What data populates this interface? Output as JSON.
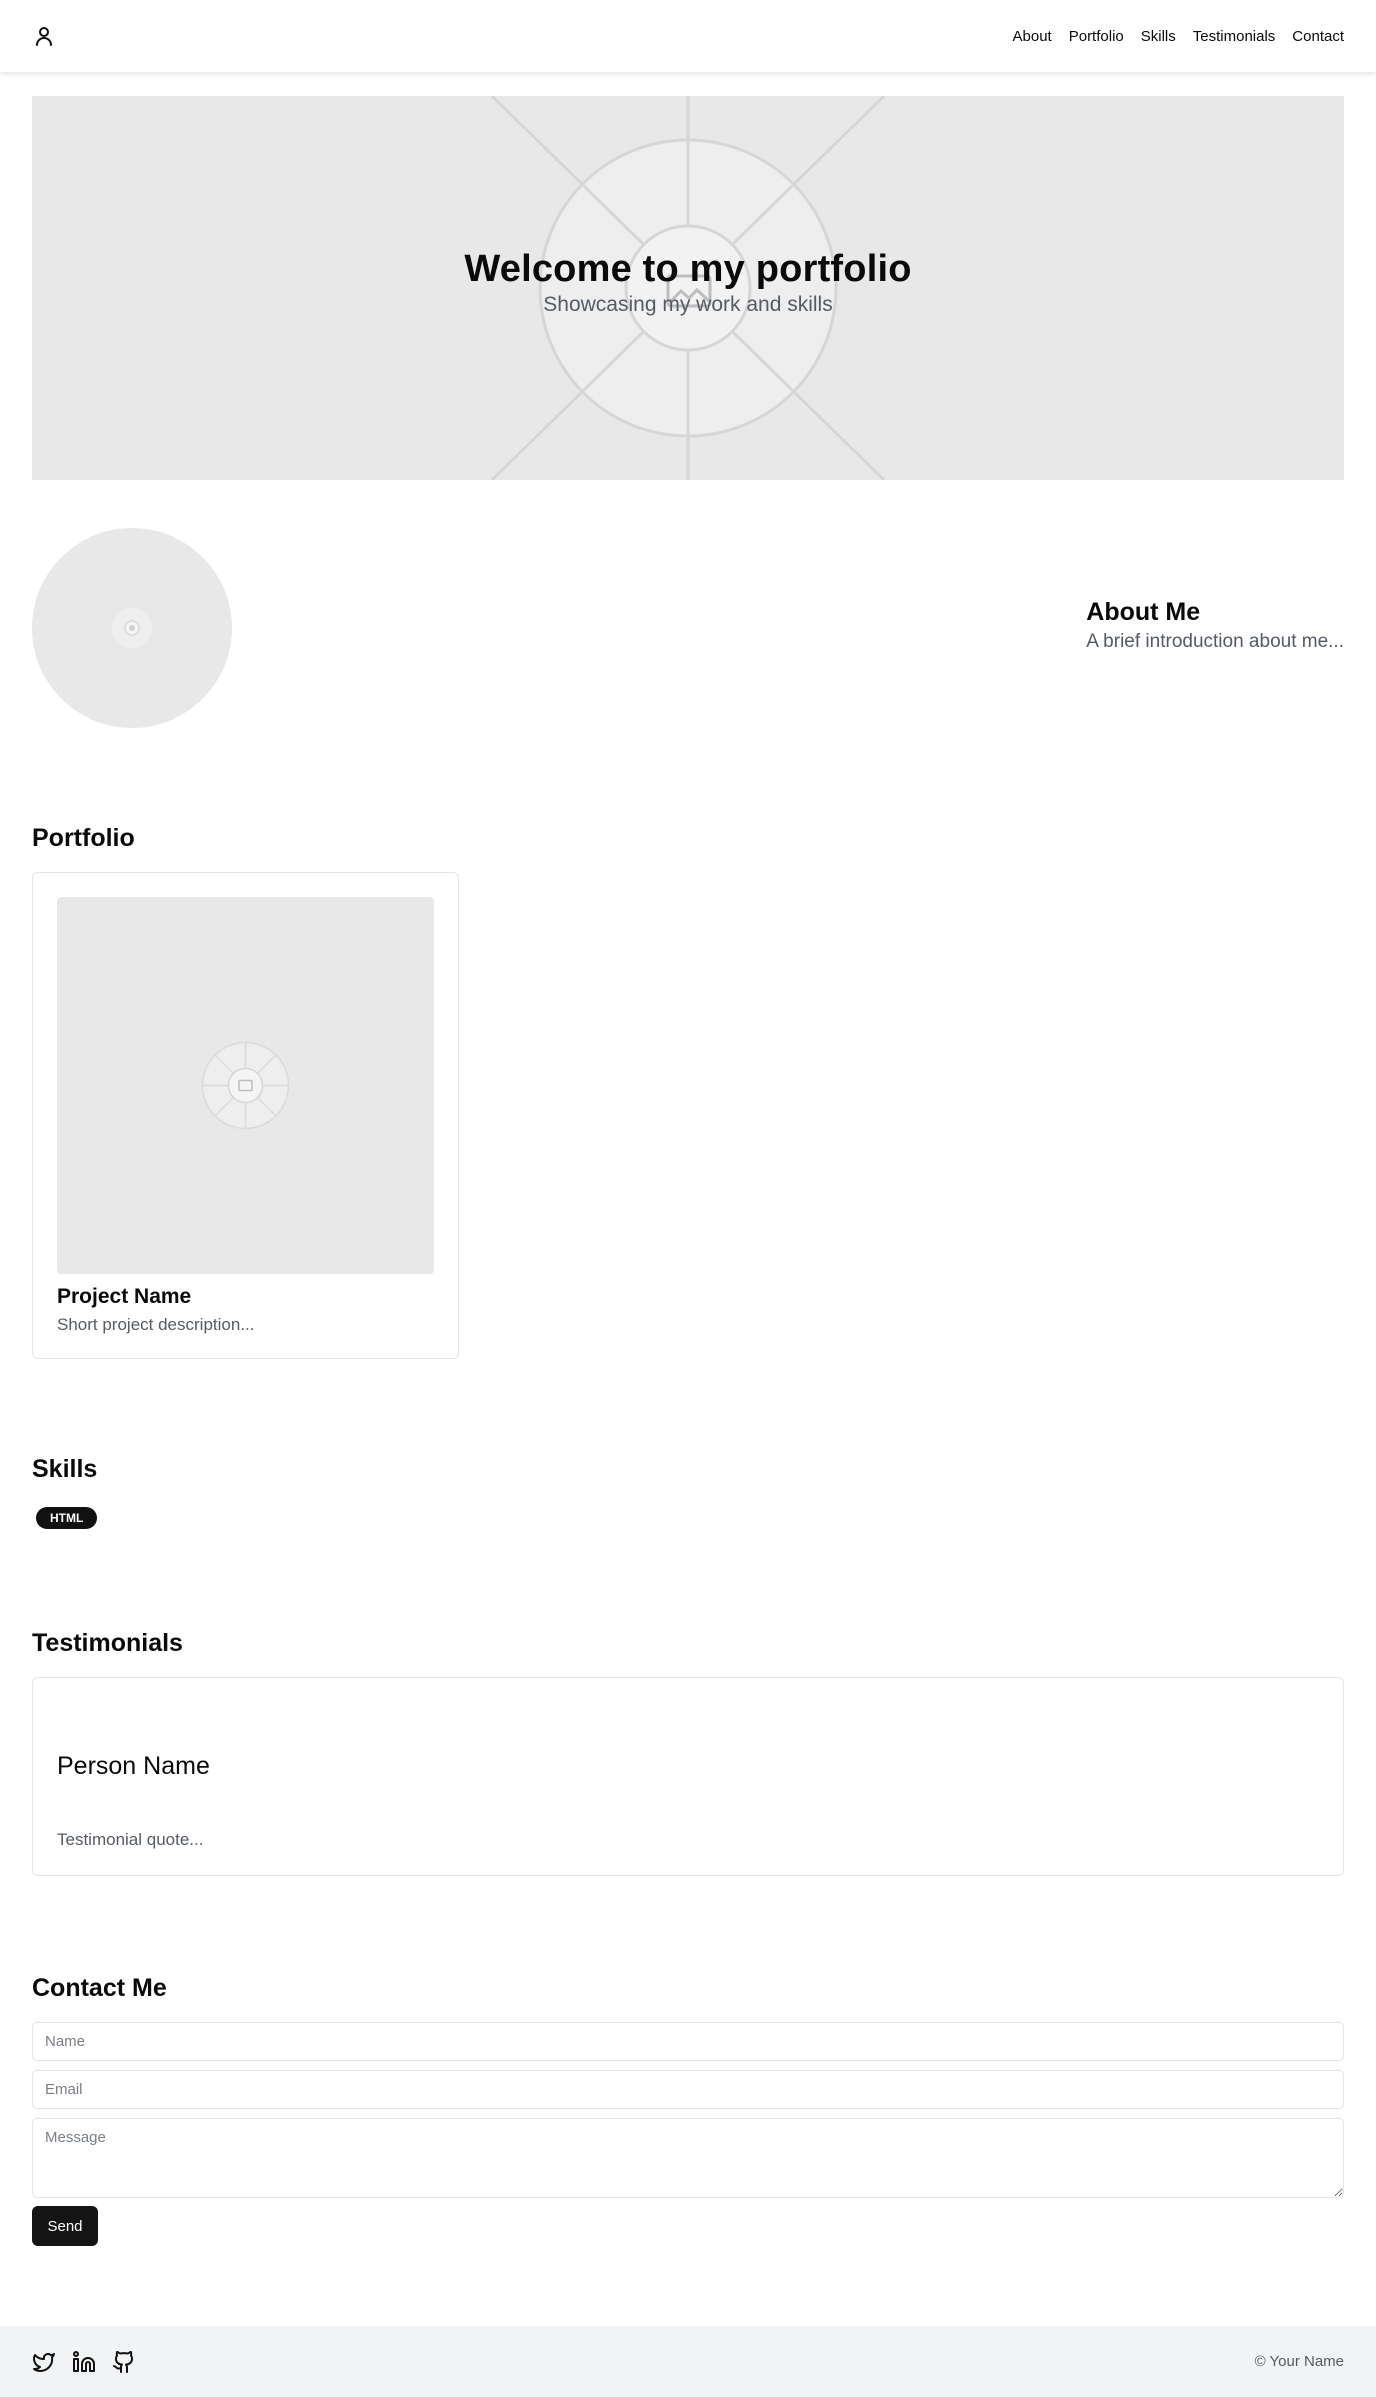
{
  "header": {
    "logo_icon": "user-icon",
    "nav": [
      "About",
      "Portfolio",
      "Skills",
      "Testimonials",
      "Contact"
    ]
  },
  "hero": {
    "title": "Welcome to my portfolio",
    "subtitle": "Showcasing my work and skills",
    "image_icon": "image-placeholder-icon"
  },
  "about": {
    "title": "About Me",
    "description": "A brief introduction about me..."
  },
  "portfolio": {
    "title": "Portfolio",
    "projects": [
      {
        "name": "Project Name",
        "description": "Short project description..."
      }
    ]
  },
  "skills": {
    "title": "Skills",
    "items": [
      "HTML"
    ]
  },
  "testimonials": {
    "title": "Testimonials",
    "items": [
      {
        "name": "Person Name",
        "quote": "Testimonial quote..."
      }
    ]
  },
  "contact": {
    "title": "Contact Me",
    "name_placeholder": "Name",
    "email_placeholder": "Email",
    "message_placeholder": "Message",
    "send_label": "Send"
  },
  "footer": {
    "social_icons": [
      "twitter-icon",
      "linkedin-icon",
      "github-icon"
    ],
    "copyright": "© Your Name"
  },
  "colors": {
    "primary": "#151515",
    "muted_text": "#555b63",
    "placeholder_bg": "#e8e8e8",
    "border": "#e2e4e8",
    "footer_bg": "#f2f3f5"
  }
}
